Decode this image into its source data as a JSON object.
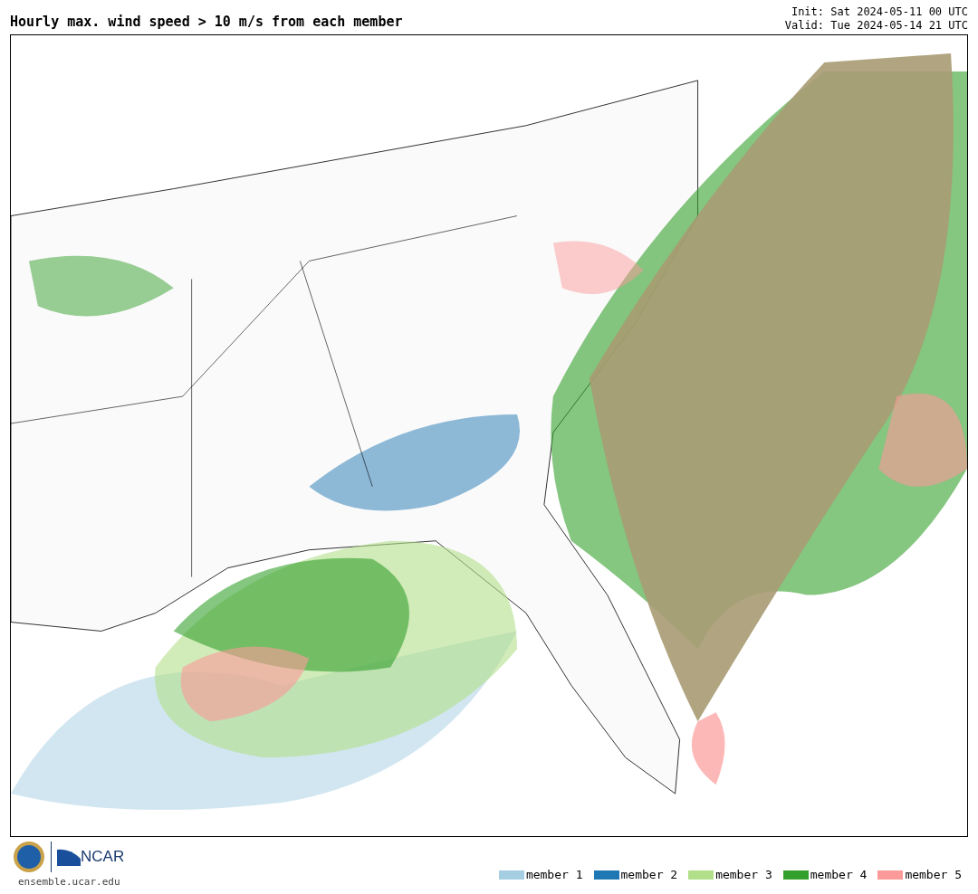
{
  "title": "Hourly max. wind speed > 10 m/s from each member",
  "init": "Init: Sat 2024-05-11 00 UTC",
  "valid": "Valid: Tue 2024-05-14 21 UTC",
  "logos": {
    "ncar": "NCAR",
    "site": "ensemble.ucar.edu"
  },
  "legend": [
    {
      "label": "member 1",
      "color": "#a6cee3"
    },
    {
      "label": "member 2",
      "color": "#1f78b4"
    },
    {
      "label": "member 3",
      "color": "#b2df8a"
    },
    {
      "label": "member 4",
      "color": "#33a02c"
    },
    {
      "label": "member 5",
      "color": "#fb9a99"
    }
  ]
}
